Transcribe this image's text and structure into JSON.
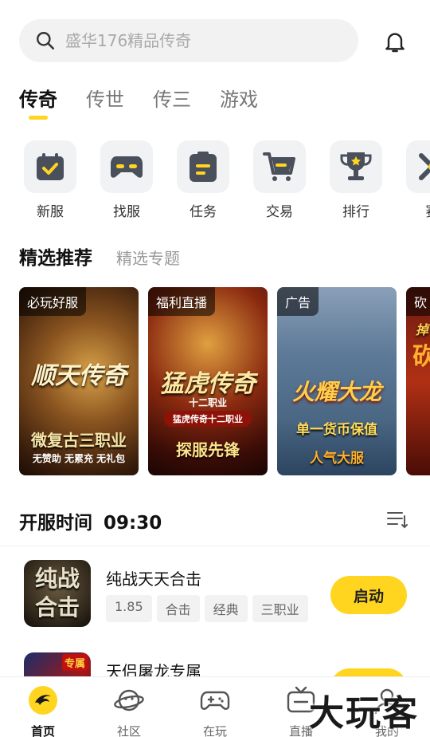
{
  "search": {
    "placeholder": "盛华176精品传奇"
  },
  "tabs": [
    {
      "label": "传奇",
      "active": true
    },
    {
      "label": "传世",
      "active": false
    },
    {
      "label": "传三",
      "active": false
    },
    {
      "label": "游戏",
      "active": false
    }
  ],
  "quick": [
    {
      "label": "新服",
      "icon": "calendar-check-icon"
    },
    {
      "label": "找服",
      "icon": "gamepad-icon"
    },
    {
      "label": "任务",
      "icon": "task-list-icon"
    },
    {
      "label": "交易",
      "icon": "cart-icon"
    },
    {
      "label": "排行",
      "icon": "trophy-icon"
    },
    {
      "label": "赛",
      "icon": "match-icon"
    }
  ],
  "section": {
    "main": "精选推荐",
    "sub": "精选专题"
  },
  "cards": [
    {
      "tag": "必玩好服",
      "title": "顺天传奇",
      "banner": "微复古三职业",
      "note": "无赞助 无累充 无礼包"
    },
    {
      "tag": "福利直播",
      "title": "猛虎传奇",
      "subtitle": "十二职业",
      "badge": "猛虎传奇十二职业",
      "banner": "探服先锋"
    },
    {
      "tag": "广告",
      "title": "火耀大龙",
      "banner": "单一货币保值",
      "note": "人气大服"
    },
    {
      "tag": "砍",
      "title": "掉",
      "banner": "砍"
    }
  ],
  "server": {
    "label": "开服时间",
    "time": "09:30"
  },
  "games": [
    {
      "name": "纯战天天合击",
      "thumb_text": "纯战合击",
      "tags": [
        "1.85",
        "合击",
        "经典",
        "三职业"
      ],
      "button": "启动"
    },
    {
      "name": "天侣屠龙专属",
      "thumb_text": "专属",
      "tags": [],
      "button": "启动"
    }
  ],
  "nav": [
    {
      "label": "首页",
      "icon": "home-logo-icon",
      "active": true
    },
    {
      "label": "社区",
      "icon": "planet-icon",
      "active": false
    },
    {
      "label": "在玩",
      "icon": "gamepad-icon",
      "active": false
    },
    {
      "label": "直播",
      "icon": "tv-icon",
      "active": false
    },
    {
      "label": "我的",
      "icon": "user-icon",
      "active": false
    }
  ],
  "watermark": "大玩客",
  "colors": {
    "accent": "#ffd51f",
    "icon": "#4a4f5c"
  }
}
